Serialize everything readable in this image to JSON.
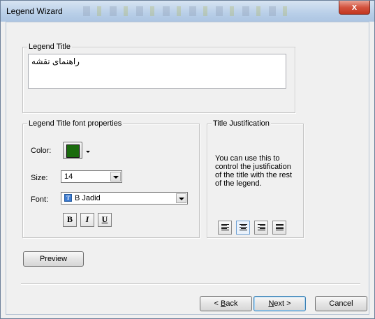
{
  "window": {
    "title": "Legend Wizard",
    "close_glyph": "x"
  },
  "legend_title_group": {
    "label": "Legend Title",
    "value": "راهنمای نقشه"
  },
  "font_group": {
    "label": "Legend Title font properties",
    "color_label": "Color:",
    "color_value": "#1a6b0d",
    "size_label": "Size:",
    "size_value": "14",
    "font_label": "Font:",
    "font_value": "B Jadid",
    "font_icon": "truetype-font-icon",
    "bold_label": "B",
    "italic_label": "I",
    "underline_label": "U"
  },
  "justify_group": {
    "label": "Title Justification",
    "description": "You can use this to control the justification of the title with the rest of the legend.",
    "buttons": [
      "align-left-icon",
      "align-center-icon",
      "align-right-icon",
      "align-justify-icon"
    ],
    "selected": "align-center-icon"
  },
  "buttons": {
    "preview": "Preview",
    "back_prefix": "< ",
    "back_accel": "B",
    "back_rest": "ack",
    "next_accel": "N",
    "next_rest": "ext >",
    "cancel": "Cancel"
  }
}
